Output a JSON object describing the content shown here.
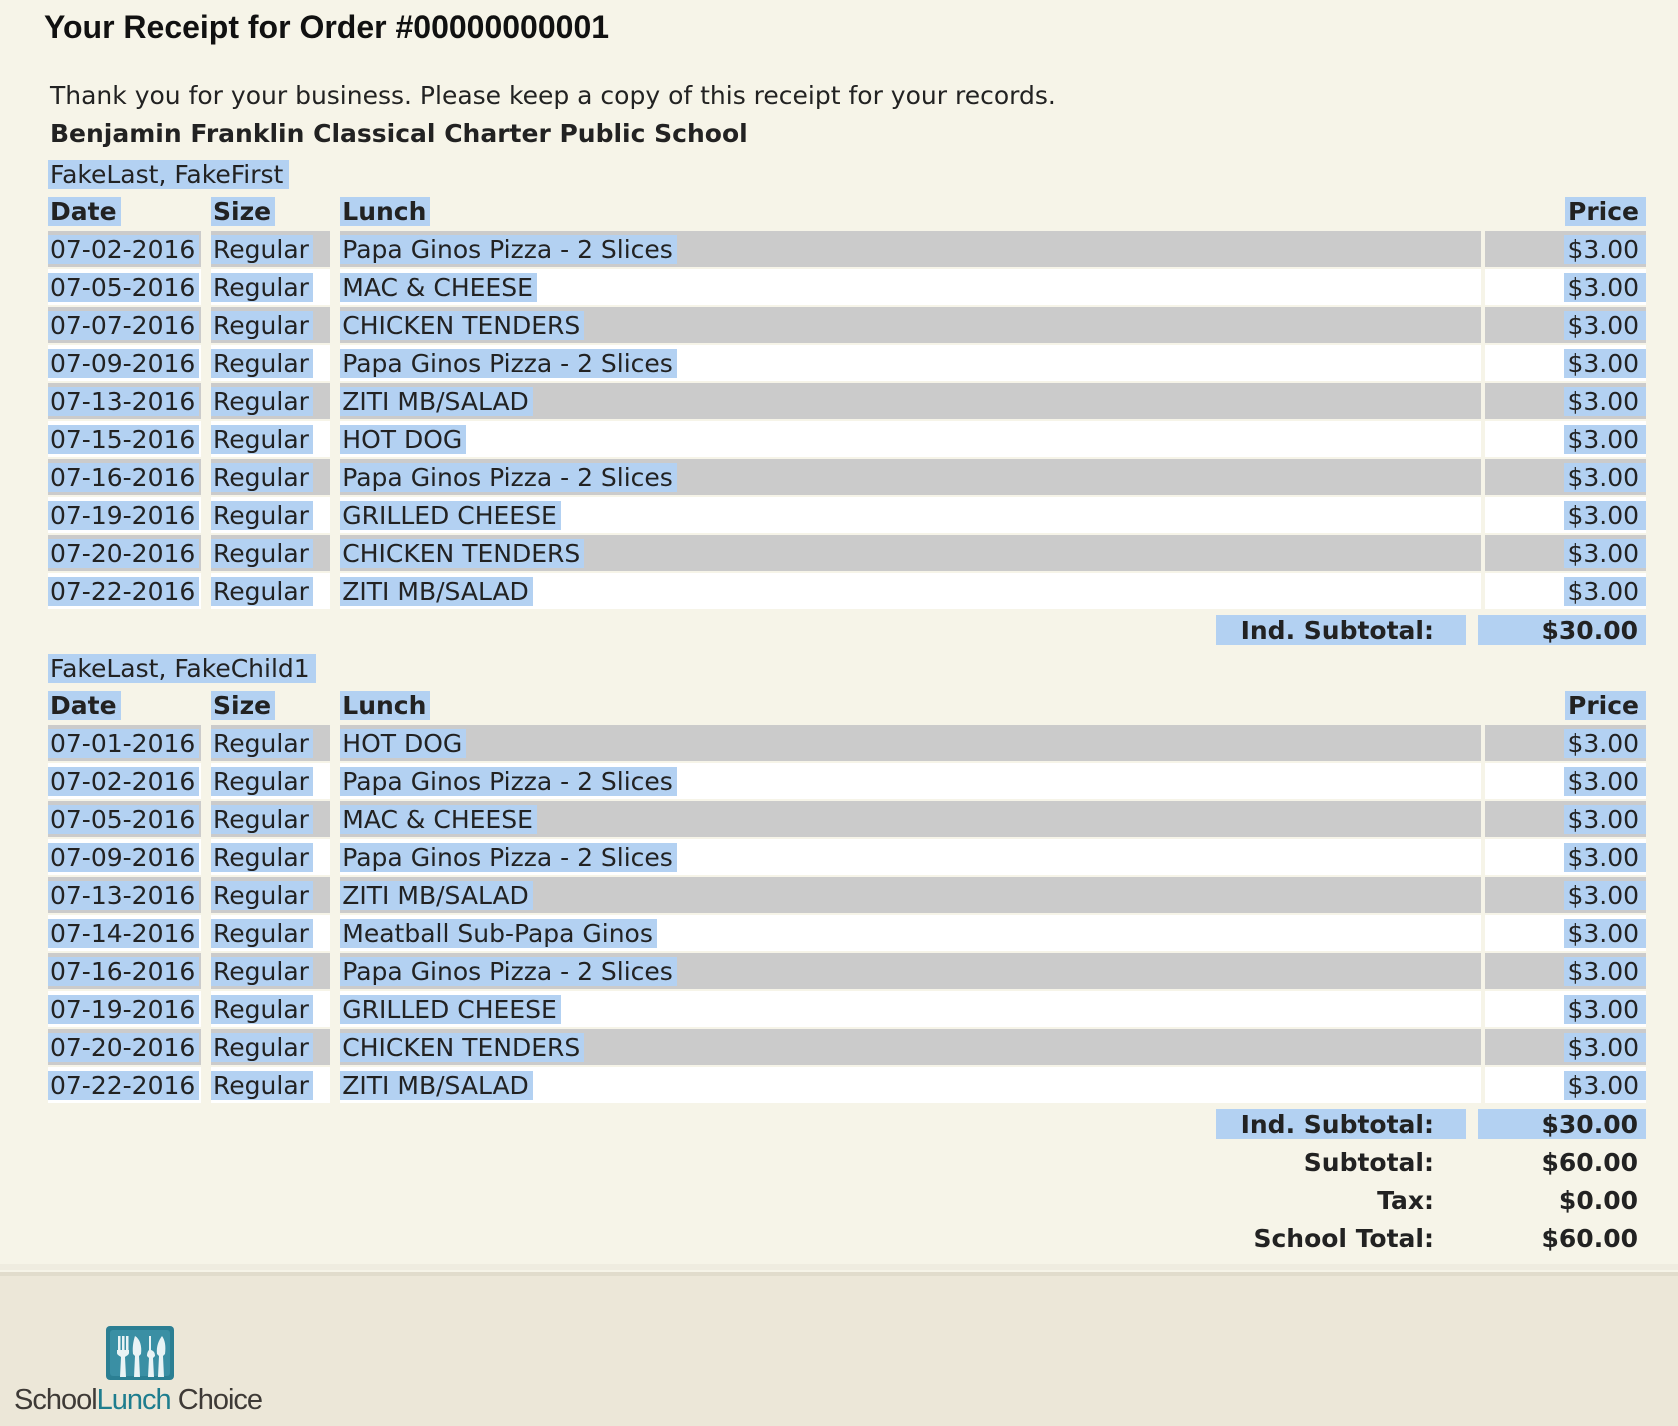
{
  "title": "Your Receipt for Order #00000000001",
  "thanks": "Thank you for your business. Please keep a copy of this receipt for your records.",
  "school": "Benjamin Franklin Classical Charter Public School",
  "columns": {
    "date": "Date",
    "size": "Size",
    "lunch": "Lunch",
    "price": "Price"
  },
  "students": [
    {
      "name": "FakeLast, FakeFirst",
      "rows": [
        {
          "date": "07-02-2016",
          "size": "Regular",
          "lunch": "Papa Ginos Pizza - 2 Slices",
          "price": "$3.00"
        },
        {
          "date": "07-05-2016",
          "size": "Regular",
          "lunch": "MAC & CHEESE",
          "price": "$3.00"
        },
        {
          "date": "07-07-2016",
          "size": "Regular",
          "lunch": "CHICKEN TENDERS",
          "price": "$3.00"
        },
        {
          "date": "07-09-2016",
          "size": "Regular",
          "lunch": "Papa Ginos Pizza - 2 Slices",
          "price": "$3.00"
        },
        {
          "date": "07-13-2016",
          "size": "Regular",
          "lunch": "ZITI MB/SALAD",
          "price": "$3.00"
        },
        {
          "date": "07-15-2016",
          "size": "Regular",
          "lunch": "HOT DOG",
          "price": "$3.00"
        },
        {
          "date": "07-16-2016",
          "size": "Regular",
          "lunch": "Papa Ginos Pizza - 2 Slices",
          "price": "$3.00"
        },
        {
          "date": "07-19-2016",
          "size": "Regular",
          "lunch": "GRILLED CHEESE",
          "price": "$3.00"
        },
        {
          "date": "07-20-2016",
          "size": "Regular",
          "lunch": "CHICKEN TENDERS",
          "price": "$3.00"
        },
        {
          "date": "07-22-2016",
          "size": "Regular",
          "lunch": "ZITI MB/SALAD",
          "price": "$3.00"
        }
      ],
      "subtotal_label": "Ind. Subtotal:",
      "subtotal": "$30.00"
    },
    {
      "name": "FakeLast, FakeChild1",
      "rows": [
        {
          "date": "07-01-2016",
          "size": "Regular",
          "lunch": "HOT DOG",
          "price": "$3.00"
        },
        {
          "date": "07-02-2016",
          "size": "Regular",
          "lunch": "Papa Ginos Pizza - 2 Slices",
          "price": "$3.00"
        },
        {
          "date": "07-05-2016",
          "size": "Regular",
          "lunch": "MAC & CHEESE",
          "price": "$3.00"
        },
        {
          "date": "07-09-2016",
          "size": "Regular",
          "lunch": "Papa Ginos Pizza - 2 Slices",
          "price": "$3.00"
        },
        {
          "date": "07-13-2016",
          "size": "Regular",
          "lunch": "ZITI MB/SALAD",
          "price": "$3.00"
        },
        {
          "date": "07-14-2016",
          "size": "Regular",
          "lunch": "Meatball Sub-Papa Ginos",
          "price": "$3.00"
        },
        {
          "date": "07-16-2016",
          "size": "Regular",
          "lunch": "Papa Ginos Pizza - 2 Slices",
          "price": "$3.00"
        },
        {
          "date": "07-19-2016",
          "size": "Regular",
          "lunch": "GRILLED CHEESE",
          "price": "$3.00"
        },
        {
          "date": "07-20-2016",
          "size": "Regular",
          "lunch": "CHICKEN TENDERS",
          "price": "$3.00"
        },
        {
          "date": "07-22-2016",
          "size": "Regular",
          "lunch": "ZITI MB/SALAD",
          "price": "$3.00"
        }
      ],
      "subtotal_label": "Ind. Subtotal:",
      "subtotal": "$30.00"
    }
  ],
  "totals": [
    {
      "label": "Subtotal:",
      "value": "$60.00"
    },
    {
      "label": "Tax:",
      "value": "$0.00"
    },
    {
      "label": "School Total:",
      "value": "$60.00"
    }
  ],
  "footer": {
    "logo_icon": "fork-knife-icon",
    "logo_word_1": "School",
    "logo_word_2": "Lunch",
    "logo_word_3": "Choice"
  },
  "colors": {
    "page_bg": "#f6f4e8",
    "selection": "#b3d1f2",
    "row_alt": "#cbcbcb",
    "logo_teal": "#1e7d8e"
  }
}
